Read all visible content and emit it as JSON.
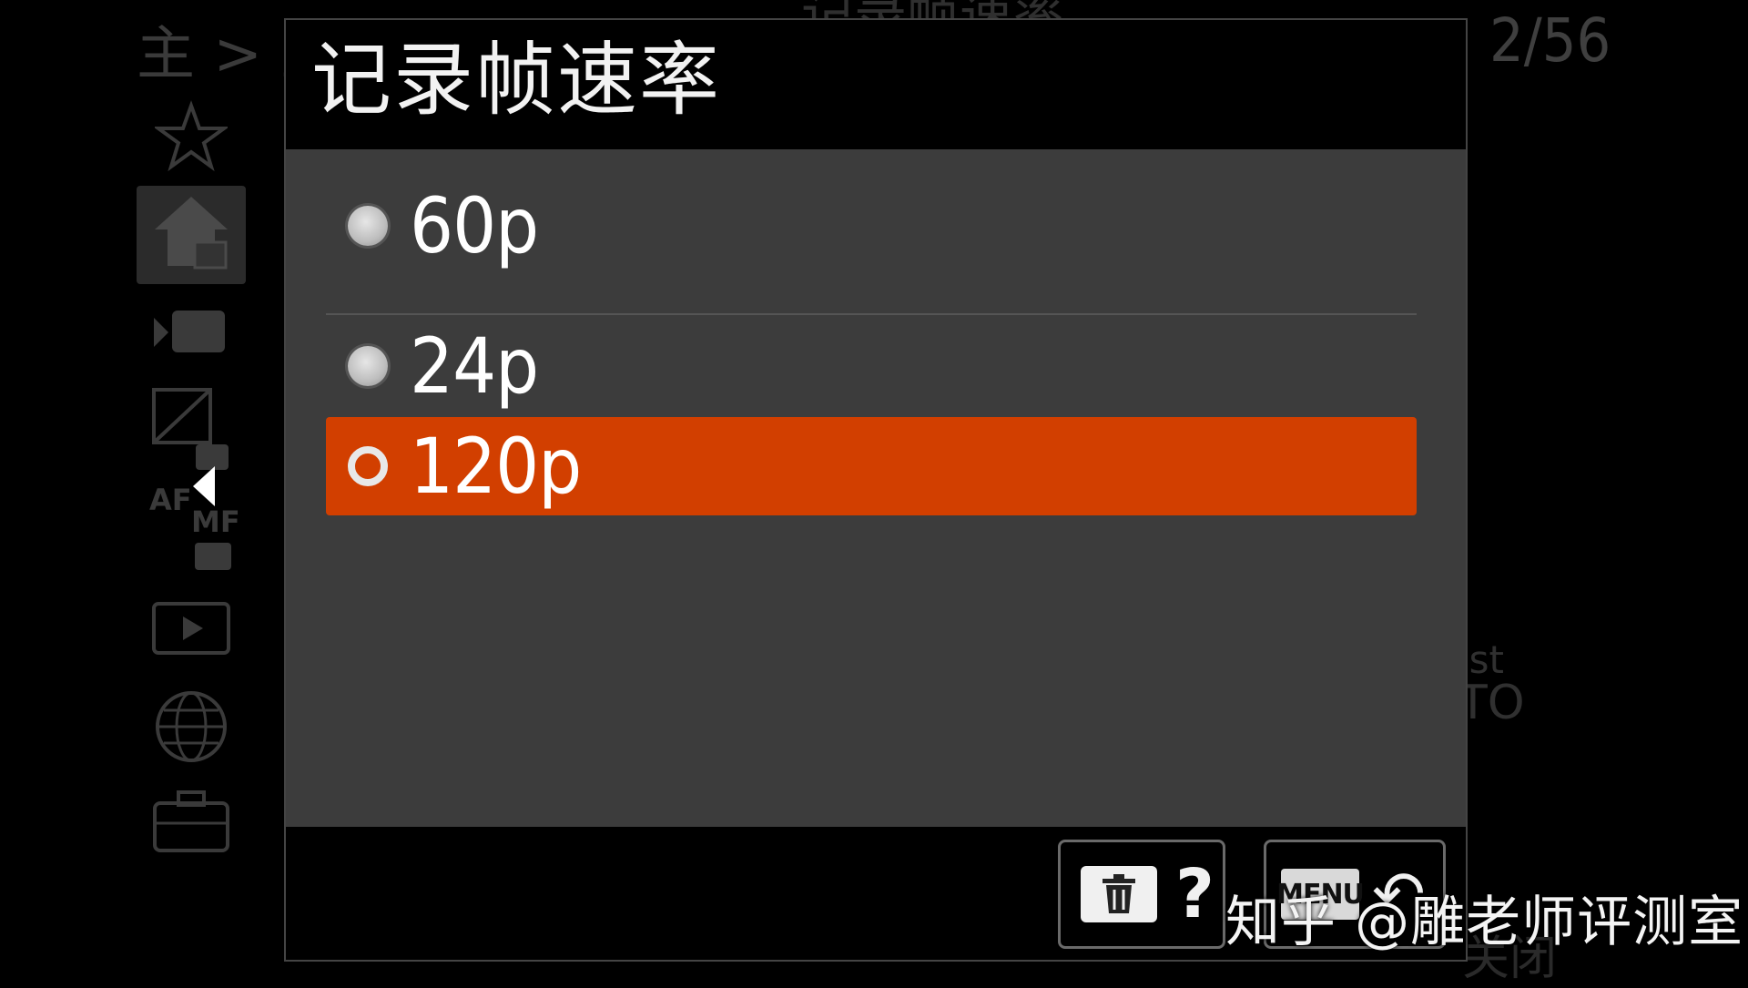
{
  "background_menu": {
    "breadcrumb": "主 > 主",
    "title": "记录帧速率",
    "page_indicator": "2/56",
    "side_text_1": "ist",
    "side_text_2": "TO",
    "side_text_3": "关闭",
    "icons": [
      "star-icon",
      "home-camera-icon",
      "movie-camera-icon",
      "exposure-icon",
      "af-mf-icon",
      "playback-icon",
      "globe-icon",
      "toolbox-icon"
    ],
    "icon_labels": {
      "af": "AF",
      "mf": "MF"
    }
  },
  "dialog": {
    "title": "记录帧速率",
    "options": [
      {
        "label": "60p",
        "selected": false
      },
      {
        "label": "24p",
        "selected": false
      },
      {
        "label": "120p",
        "selected": true
      }
    ],
    "selected_color": "#d23f00",
    "footer": {
      "help_symbol": "?",
      "menu_label": "MENU",
      "back_symbol": "↶"
    }
  },
  "watermark": "知乎 @雕老师评测室"
}
